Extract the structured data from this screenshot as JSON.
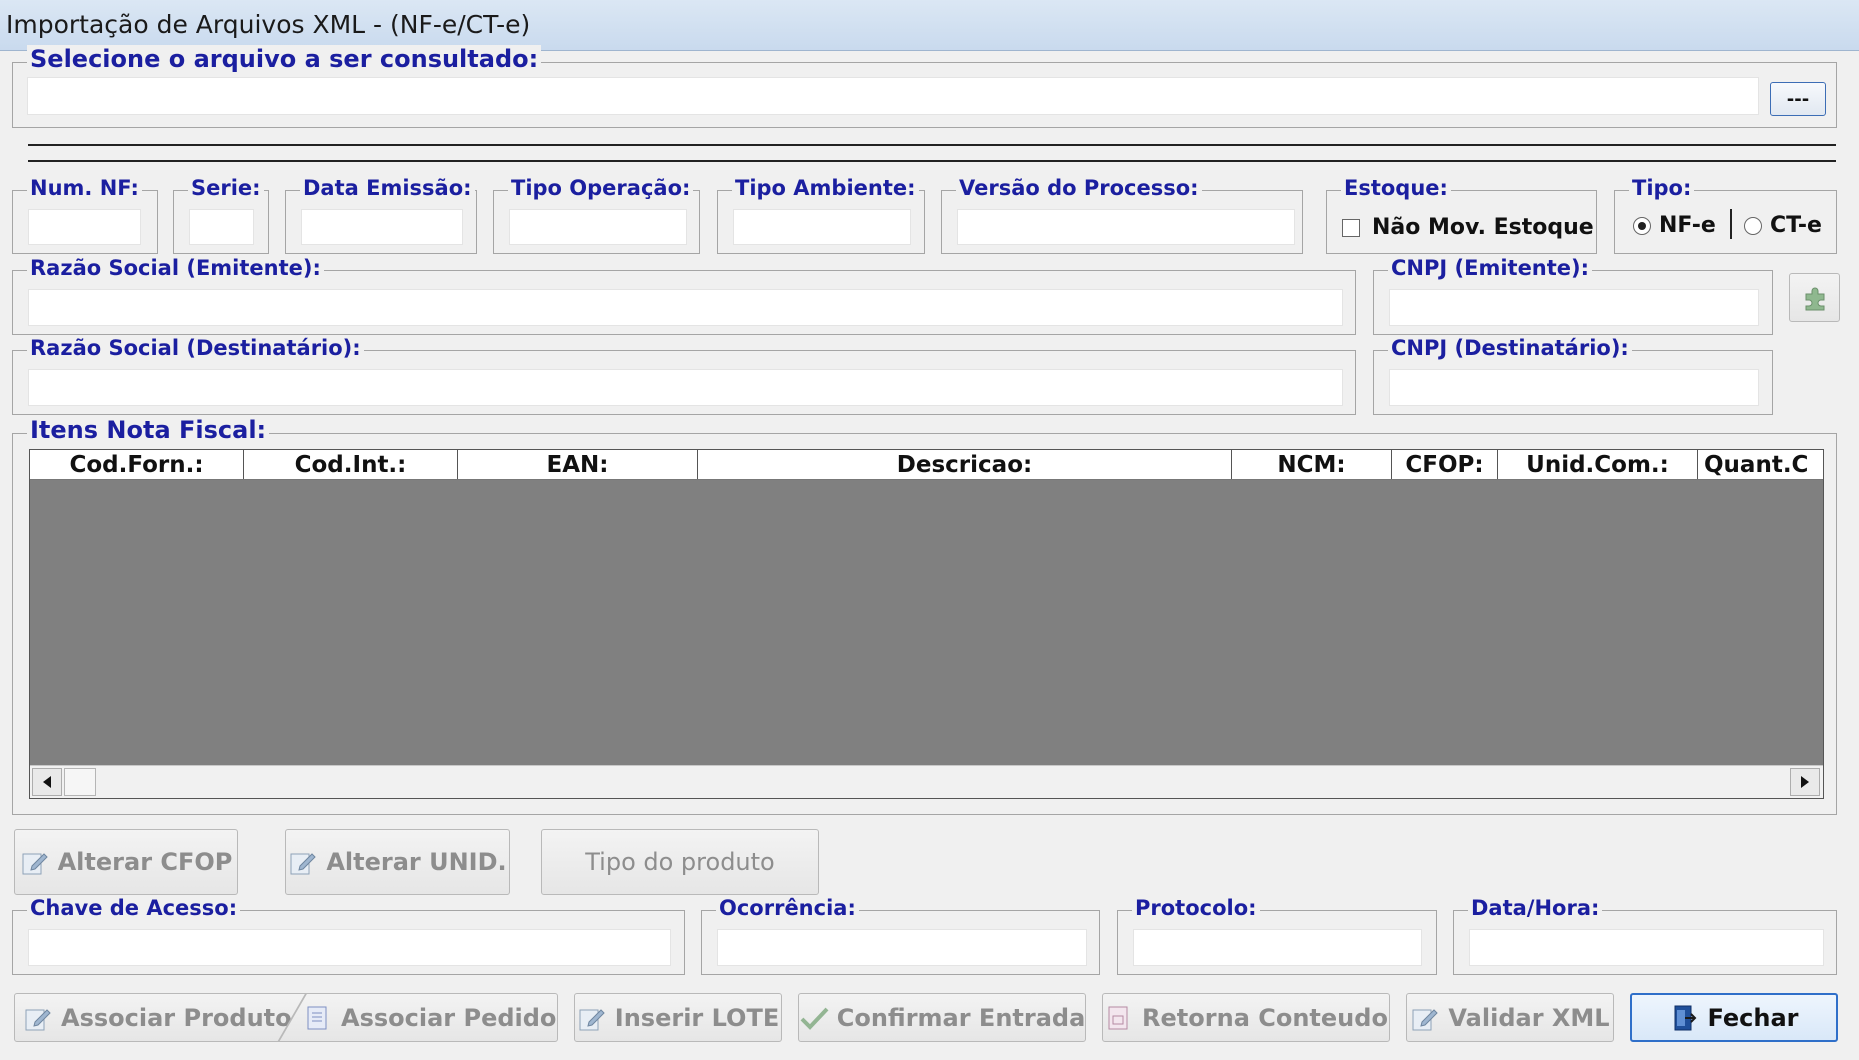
{
  "window": {
    "title": "Importação de Arquivos XML - (NF-e/CT-e)"
  },
  "file_select": {
    "label": "Selecione o arquivo a ser consultado:",
    "value": "",
    "browse_label": "---"
  },
  "fields": {
    "num_nf": {
      "label": "Num. NF:",
      "value": ""
    },
    "serie": {
      "label": "Serie:",
      "value": ""
    },
    "data_emissao": {
      "label": "Data Emissão:",
      "value": ""
    },
    "tipo_operacao": {
      "label": "Tipo Operação:",
      "value": ""
    },
    "tipo_ambiente": {
      "label": "Tipo Ambiente:",
      "value": ""
    },
    "versao_processo": {
      "label": "Versão do Processo:",
      "value": ""
    },
    "razao_emitente": {
      "label": "Razão Social (Emitente):",
      "value": ""
    },
    "cnpj_emitente": {
      "label": "CNPJ (Emitente):",
      "value": ""
    },
    "razao_destinatario": {
      "label": "Razão Social (Destinatário):",
      "value": ""
    },
    "cnpj_destinatario": {
      "label": "CNPJ (Destinatário):",
      "value": ""
    },
    "chave_acesso": {
      "label": "Chave de Acesso:",
      "value": ""
    },
    "ocorrencia": {
      "label": "Ocorrência:",
      "value": ""
    },
    "protocolo": {
      "label": "Protocolo:",
      "value": ""
    },
    "data_hora": {
      "label": "Data/Hora:",
      "value": ""
    }
  },
  "estoque": {
    "label": "Estoque:",
    "checkbox_label": "Não Mov. Estoque",
    "checked": false
  },
  "tipo": {
    "label": "Tipo:",
    "options": [
      "NF-e",
      "CT-e"
    ],
    "selected": "NF-e"
  },
  "items": {
    "label": "Itens Nota Fiscal:",
    "columns": [
      "Cod.Forn.:",
      "Cod.Int.:",
      "EAN:",
      "Descricao:",
      "NCM:",
      "CFOP:",
      "Unid.Com.:",
      "Quant.C"
    ],
    "rows": []
  },
  "actions_mid": {
    "alterar_cfop": "Alterar CFOP",
    "alterar_unid": "Alterar UNID.",
    "tipo_produto": "Tipo do produto"
  },
  "actions_bottom": {
    "associar_produto": "Associar Produto",
    "associar_pedido": "Associar Pedido",
    "inserir_lote": "Inserir LOTE",
    "confirmar_entrada": "Confirmar Entrada",
    "retorna_conteudo": "Retorna Conteudo",
    "validar_xml": "Validar XML",
    "fechar": "Fechar"
  },
  "colors": {
    "label_blue": "#1b1fa0",
    "grid_bg": "#808080",
    "disabled_text": "#8d8d8d"
  }
}
